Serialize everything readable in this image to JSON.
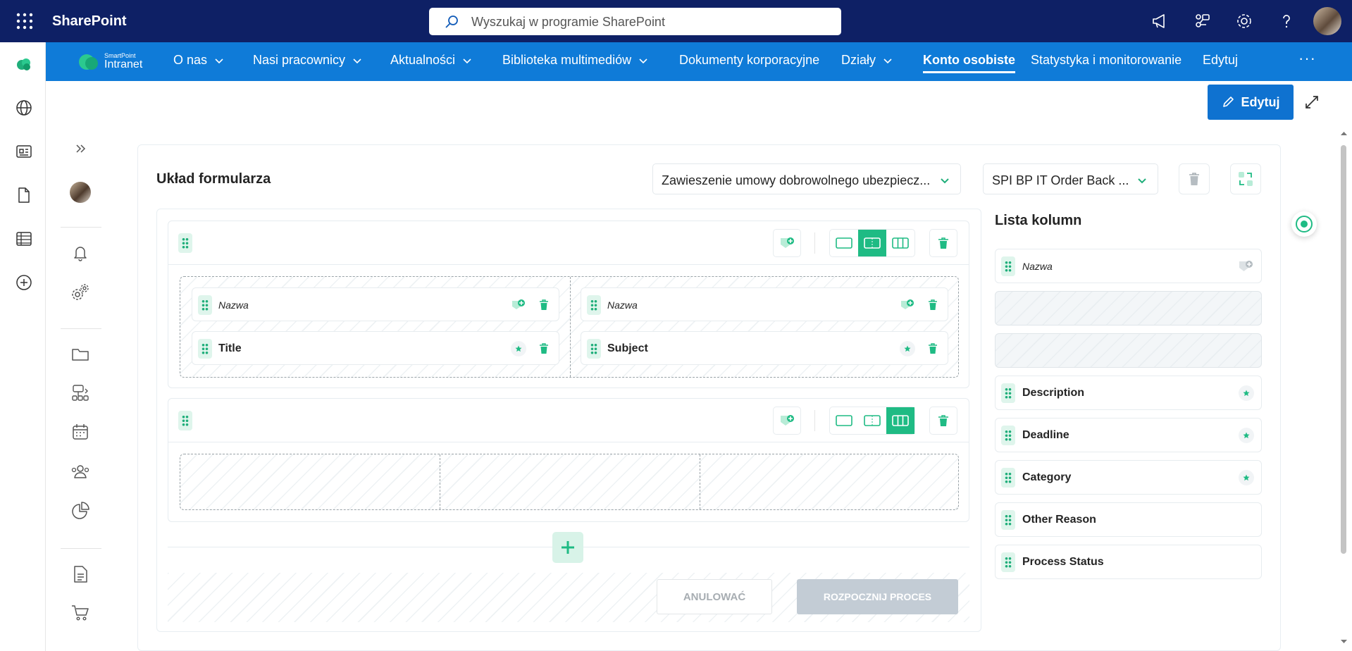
{
  "suite": {
    "brand": "SharePoint",
    "search_placeholder": "Wyszukaj w programie SharePoint"
  },
  "nav": {
    "logo_small": "SmartPoint",
    "logo_big": "Intranet",
    "items": [
      {
        "label": "O nas"
      },
      {
        "label": "Nasi pracownicy"
      },
      {
        "label": "Aktualności"
      },
      {
        "label": "Biblioteka multimediów"
      },
      {
        "label": "Dokumenty korporacyjne"
      },
      {
        "label": "Działy"
      },
      {
        "label": "Konto osobiste"
      },
      {
        "label": "Statystyka i monitorowanie"
      },
      {
        "label": "Edytuj"
      }
    ],
    "more": "···"
  },
  "page": {
    "edit_label": "Edytuj"
  },
  "form": {
    "title": "Układ formularza",
    "dropdown1": "Zawieszenie umowy dobrowolnego ubezpiecz...",
    "dropdown2": "SPI BP IT Order Back ..."
  },
  "rows": {
    "row1": {
      "col1": [
        {
          "label": "Nazwa"
        },
        {
          "label": "Title"
        }
      ],
      "col2": [
        {
          "label": "Nazwa"
        },
        {
          "label": "Subject"
        }
      ]
    }
  },
  "buttons": {
    "cancel": "ANULOWAĆ",
    "start": "ROZPOCZNIJ PROCES"
  },
  "column_list": {
    "title": "Lista kolumn",
    "items": [
      {
        "label": "Nazwa"
      },
      {
        "label": "Description"
      },
      {
        "label": "Deadline"
      },
      {
        "label": "Category"
      },
      {
        "label": "Other Reason"
      },
      {
        "label": "Process Status"
      }
    ]
  },
  "colors": {
    "suite": "#0e2065",
    "nav": "#0f7bd8",
    "accent": "#1fbb84",
    "primary_button": "#0f72d0"
  }
}
